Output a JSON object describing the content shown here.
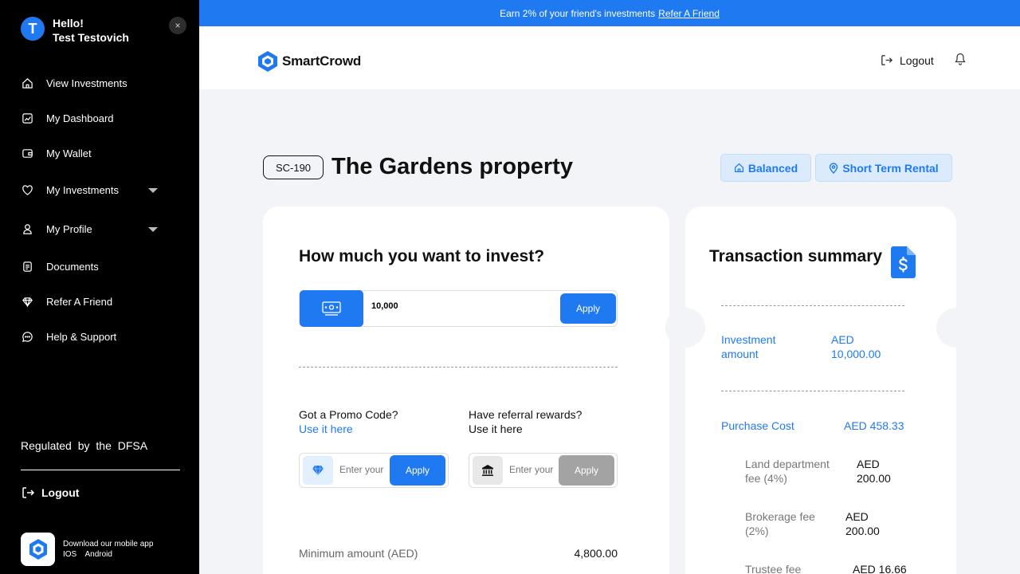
{
  "sidebar": {
    "greeting": "Hello!",
    "user_name": "Test Testovich",
    "avatar_initial": "T",
    "close_symbol": "×",
    "items": [
      {
        "label": "View Investments",
        "icon": "home-icon"
      },
      {
        "label": "My Dashboard",
        "icon": "dashboard-icon"
      },
      {
        "label": "My Wallet",
        "icon": "wallet-icon"
      },
      {
        "label": "My Investments",
        "icon": "heart-icon"
      },
      {
        "label": "My Profile",
        "icon": "user-icon"
      },
      {
        "label": "Documents",
        "icon": "document-icon"
      },
      {
        "label": "Refer A Friend",
        "icon": "diamond-icon"
      },
      {
        "label": "Help & Support",
        "icon": "chat-icon"
      }
    ],
    "regulated": "Regulated by the DFSA",
    "logout": "Logout",
    "app_promo": {
      "text": "Download our mobile app",
      "ios": "IOS",
      "android": "Android"
    }
  },
  "banner": {
    "text": "Earn 2% of your friend's investments",
    "link": "Refer A Friend"
  },
  "header": {
    "brand": "SmartCrowd",
    "logout": "Logout"
  },
  "property": {
    "code": "SC-190",
    "title": "The Gardens property",
    "tags": [
      "Balanced",
      "Short Term Rental"
    ]
  },
  "invest": {
    "heading": "How much you want to invest?",
    "amount_value": "10,000",
    "apply": "Apply",
    "promo_title": "Got a Promo Code?",
    "promo_link": "Use it here",
    "promo_placeholder": "Enter your",
    "promo_apply": "Apply",
    "referral_title": "Have referral rewards?",
    "referral_link": "Use it here",
    "referral_placeholder": "Enter your",
    "referral_apply": "Apply",
    "min_label": "Minimum amount (AED)",
    "min_value": "4,800.00"
  },
  "summary": {
    "heading": "Transaction summary",
    "investment_label": "Investment amount",
    "investment_value": "AED 10,000.00",
    "purchase_label": "Purchase Cost",
    "purchase_value": "AED 458.33",
    "land_label": "Land department fee (4%)",
    "land_value": "AED 200.00",
    "brokerage_label": "Brokerage fee (2%)",
    "brokerage_value": "AED 200.00",
    "trustee_label": "Trustee fee",
    "trustee_value": "AED 16.66"
  },
  "colors": {
    "accent": "#1f7af2",
    "sidebar_bg": "#000000",
    "page_bg": "#f3f4f7"
  }
}
